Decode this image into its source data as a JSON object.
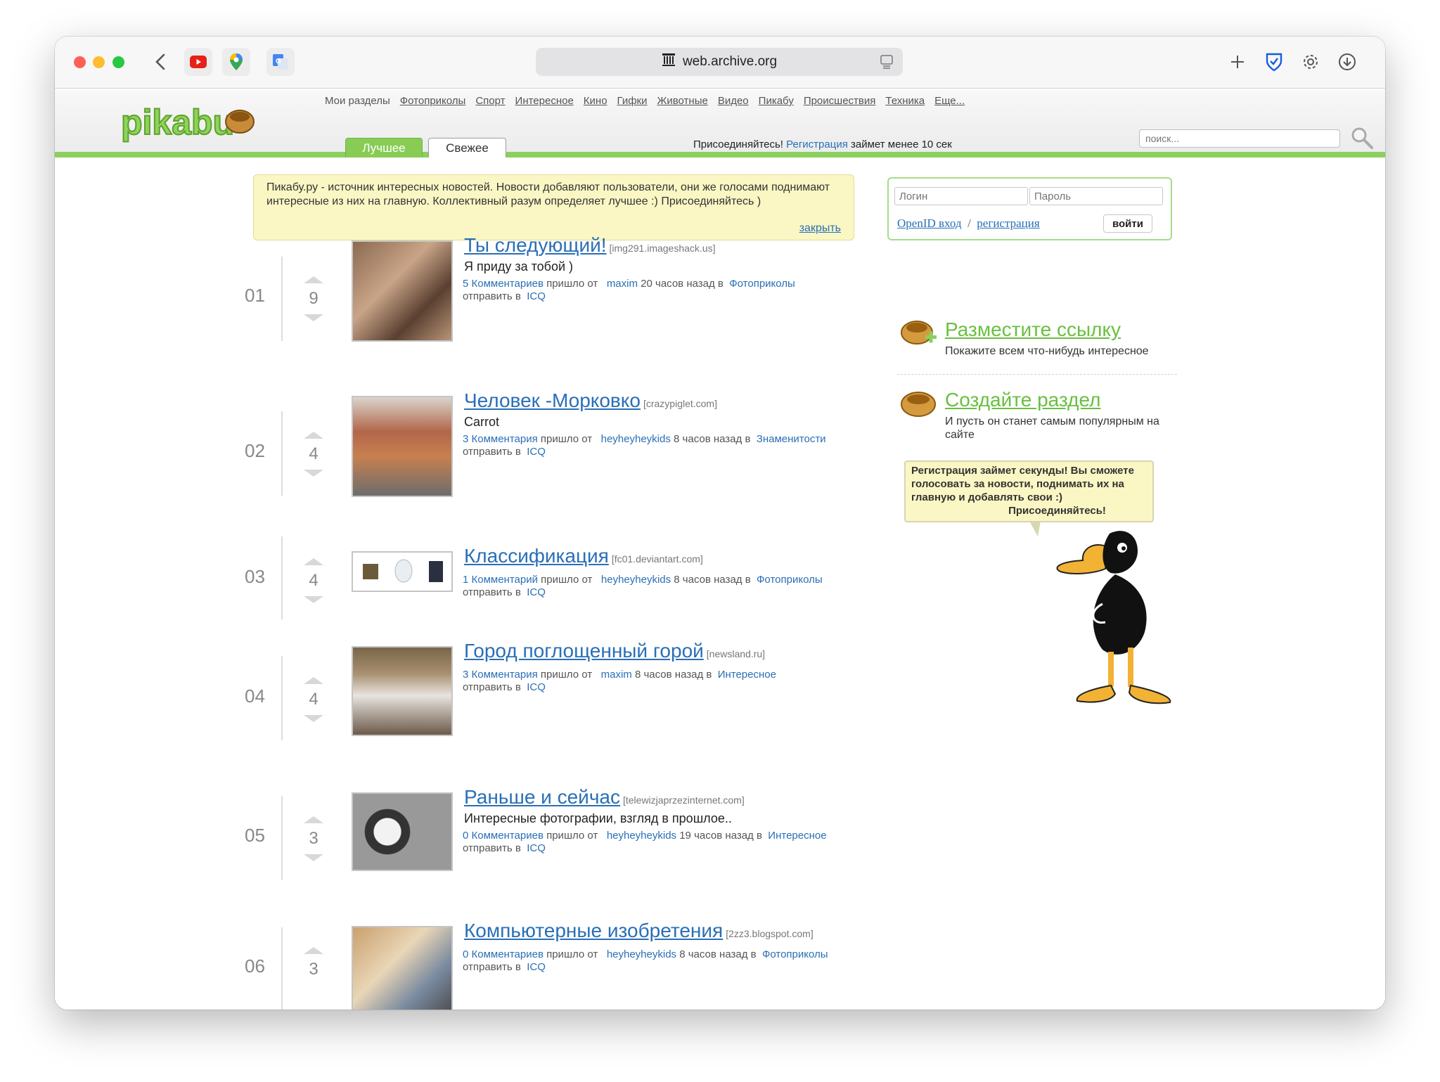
{
  "browser": {
    "url": "web.archive.org"
  },
  "header": {
    "logo_text": "pikabu",
    "nav": [
      "Мои разделы",
      "Фотоприколы",
      "Спорт",
      "Интересное",
      "Кино",
      "Гифки",
      "Животные",
      "Видео",
      "Пикабу",
      "Происшествия",
      "Техника",
      "Еще..."
    ],
    "tabs": {
      "best": "Лучшее",
      "fresh": "Свежее"
    },
    "join_prefix": "Присоединяйтесь!",
    "join_link": "Регистрация",
    "join_suffix": "займет менее 10 сек",
    "search_placeholder": "поиск..."
  },
  "notice": {
    "text": "Пикабу.ру - источник интересных новостей. Новости добавляют пользователи, они же голосами поднимают интересные из них на главную. Коллективный разум определяет лучшее :) Присоединяйтесь )",
    "close": "закрыть"
  },
  "login": {
    "login_placeholder": "Логин",
    "password_placeholder": "Пароль",
    "openid": "OpenID вход",
    "separator": "/",
    "register": "регистрация",
    "submit": "войти"
  },
  "posts": [
    {
      "rank": "01",
      "votes": "9",
      "title": "Ты следующий!",
      "source": "[img291.imageshack.us]",
      "desc": "Я приду за тобой )",
      "comments": "5 Комментариев",
      "came_from": "пришло от",
      "author": "maxim",
      "time": "20 часов назад в",
      "section": "Фотоприколы",
      "send": "отправить в",
      "icq": "ICQ"
    },
    {
      "rank": "02",
      "votes": "4",
      "title": "Человек -Морковко",
      "source": "[crazypiglet.com]",
      "desc": "Carrot",
      "comments": "3 Комментария",
      "came_from": "пришло от",
      "author": "heyheyheykids",
      "time": "8 часов назад в",
      "section": "Знаменитости",
      "send": "отправить в",
      "icq": "ICQ"
    },
    {
      "rank": "03",
      "votes": "4",
      "title": "Классификация",
      "source": "[fc01.deviantart.com]",
      "desc": "",
      "comments": "1 Комментарий",
      "came_from": "пришло от",
      "author": "heyheyheykids",
      "time": "8 часов назад в",
      "section": "Фотоприколы",
      "send": "отправить в",
      "icq": "ICQ"
    },
    {
      "rank": "04",
      "votes": "4",
      "title": "Город поглощенный горой",
      "source": "[newsland.ru]",
      "desc": "",
      "comments": "3 Комментария",
      "came_from": "пришло от",
      "author": "maxim",
      "time": "8 часов назад в",
      "section": "Интересное",
      "send": "отправить в",
      "icq": "ICQ"
    },
    {
      "rank": "05",
      "votes": "3",
      "title": "Раньше и сейчас",
      "source": "[telewizjaprzezinternet.com]",
      "desc": "Интересные фотографии, взгляд в прошлое..",
      "comments": "0 Комментариев",
      "came_from": "пришло от",
      "author": "heyheyheykids",
      "time": "19 часов назад в",
      "section": "Интересное",
      "send": "отправить в",
      "icq": "ICQ"
    },
    {
      "rank": "06",
      "votes": "3",
      "title": "Компьютерные изобретения",
      "source": "[2zz3.blogspot.com]",
      "desc": "",
      "comments": "0 Комментариев",
      "came_from": "пришло от",
      "author": "heyheyheykids",
      "time": "8 часов назад в",
      "section": "Фотоприколы",
      "send": "отправить в",
      "icq": "ICQ"
    }
  ],
  "sidebar": {
    "add_link_title": "Разместите ссылку",
    "add_link_desc": "Покажите всем что-нибудь интересное",
    "create_section_title": "Создайте раздел",
    "create_section_desc": "И пусть он станет самым популярным на сайте",
    "bubble_text": "Регистрация займет секунды! Вы сможете голосовать за новости, поднимать их на главную и добавлять свои :)",
    "bubble_cta": "Присоединяйтесь!"
  }
}
